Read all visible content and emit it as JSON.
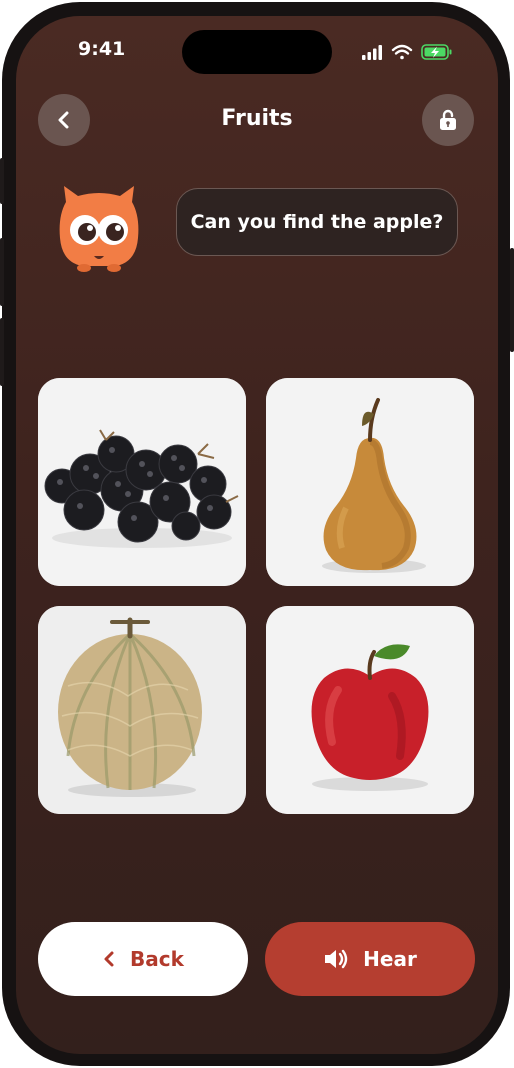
{
  "status_bar": {
    "time": "9:41",
    "icons": [
      "cellular-signal-icon",
      "wifi-icon",
      "battery-charging-icon"
    ]
  },
  "header": {
    "title": "Fruits",
    "back_icon": "chevron-left-icon",
    "lock_icon": "unlock-icon"
  },
  "prompt": {
    "text": "Can you find the apple?",
    "mascot": "owl-mascot"
  },
  "choices": [
    {
      "fruit": "blackberries"
    },
    {
      "fruit": "pear"
    },
    {
      "fruit": "cantaloupe"
    },
    {
      "fruit": "apple"
    }
  ],
  "buttons": {
    "back_label": "Back",
    "hear_label": "Hear"
  },
  "colors": {
    "background": "#3e231e",
    "accent": "#b53e30",
    "mascot": "#f27d45"
  }
}
